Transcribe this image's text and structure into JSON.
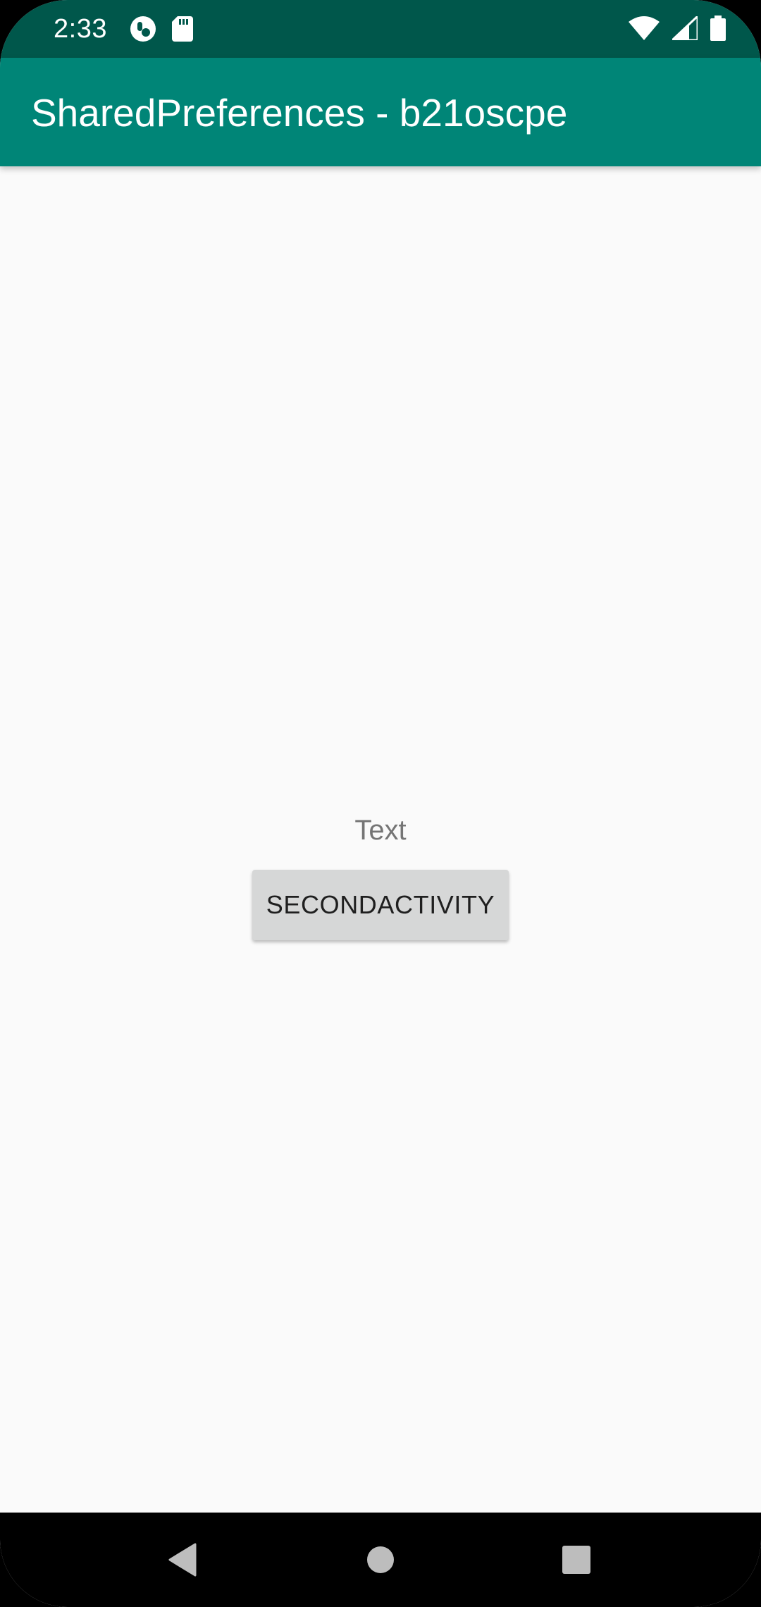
{
  "status_bar": {
    "time": "2:33",
    "left_icons": [
      "sync-icon",
      "sd-card-icon"
    ],
    "right_icons": [
      "wifi-icon",
      "cell-signal-icon",
      "battery-icon"
    ]
  },
  "app_bar": {
    "title": "SharedPreferences - b21oscpe"
  },
  "content": {
    "text_label": "Text",
    "button_label": "SECONDACTIVITY"
  },
  "nav_bar": {
    "buttons": [
      "back-icon",
      "home-icon",
      "recents-icon"
    ]
  },
  "colors": {
    "status_bar": "#00574b",
    "app_bar": "#008577",
    "background": "#fafafa",
    "button": "#d6d7d7"
  }
}
